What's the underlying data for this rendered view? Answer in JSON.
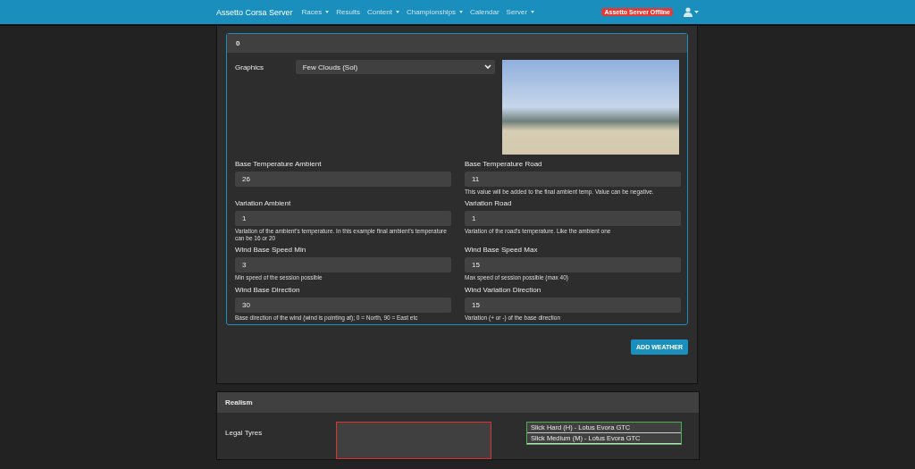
{
  "navbar": {
    "brand": "Assetto Corsa Server",
    "items": [
      {
        "label": "Races",
        "dropdown": true
      },
      {
        "label": "Results",
        "dropdown": false
      },
      {
        "label": "Content",
        "dropdown": true
      },
      {
        "label": "Championships",
        "dropdown": true
      },
      {
        "label": "Calendar",
        "dropdown": false
      },
      {
        "label": "Server",
        "dropdown": true
      }
    ],
    "status_badge": "Assetto Server Offline"
  },
  "weather": {
    "title": "0",
    "graphics": {
      "label": "Graphics",
      "value": "Few Clouds (Sol)"
    },
    "fields": [
      {
        "label": "Base Temperature Ambient",
        "value": "26"
      },
      {
        "label": "Base Temperature Road",
        "value": "11",
        "help": "This value will be added to the final ambient temp. Value can be negative."
      },
      {
        "label": "Variation Ambient",
        "value": "1",
        "help": "Variation of the ambient's temperature. In this example final ambient's temperature can be 16 or 20"
      },
      {
        "label": "Variation Road",
        "value": "1",
        "help": "Variation of the road's temperature. Like the ambient one"
      },
      {
        "label": "Wind Base Speed Min",
        "value": "3",
        "help": "Min speed of the session possible"
      },
      {
        "label": "Wind Base Speed Max",
        "value": "15",
        "help": "Max speed of session possible (max 40)"
      },
      {
        "label": "Wind Base Direction",
        "value": "30",
        "help": "Base direction of the wind (wind is pointing at); 0 = North, 90 = East etc"
      },
      {
        "label": "Wind Variation Direction",
        "value": "15",
        "help": "Variation (+ or -) of the base direction"
      }
    ],
    "add_button": "ADD WEATHER"
  },
  "realism": {
    "title": "Realism",
    "legal_tyres": {
      "label": "Legal Tyres",
      "options": [
        "Slick Hard (H) - Lotus Evora GTC",
        "Slick Medium (M) - Lotus Evora GTC"
      ]
    }
  }
}
